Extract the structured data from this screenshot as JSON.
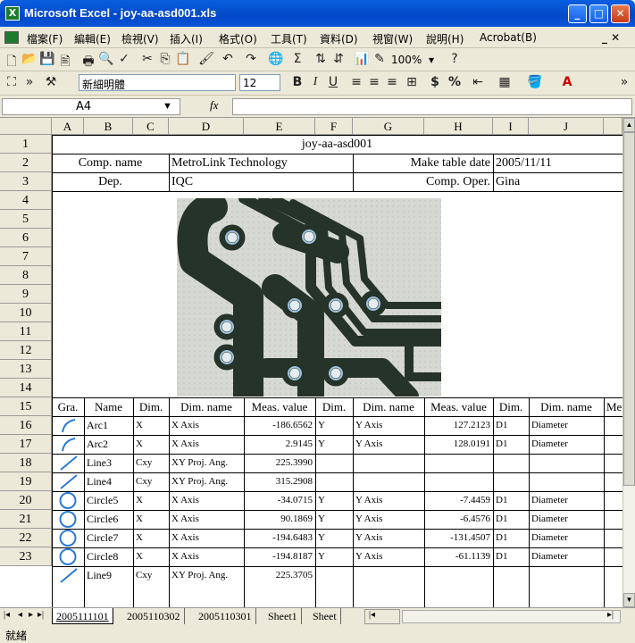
{
  "window": {
    "title": "Microsoft Excel - joy-aa-asd001.xls",
    "app_icon": "X"
  },
  "menu": [
    "檔案(F)",
    "編輯(E)",
    "檢視(V)",
    "插入(I)",
    "格式(O)",
    "工具(T)",
    "資料(D)",
    "視窗(W)",
    "說明(H)",
    "Acrobat(B)"
  ],
  "toolbar": {
    "zoom": "100%",
    "font": "新細明體",
    "font_size": "12",
    "bold": "B",
    "italic": "I",
    "underline": "U",
    "currency": "$",
    "percent": "%"
  },
  "formula_bar": {
    "name_box": "A4",
    "fx": "fx",
    "value": ""
  },
  "columns": [
    "A",
    "B",
    "C",
    "D",
    "E",
    "F",
    "G",
    "H",
    "I",
    "J"
  ],
  "rows": [
    "1",
    "2",
    "3",
    "4",
    "5",
    "6",
    "7",
    "8",
    "9",
    "10",
    "11",
    "12",
    "13",
    "14",
    "15",
    "16",
    "17",
    "18",
    "19",
    "20",
    "21",
    "22",
    "23"
  ],
  "sheet": {
    "title": "joy-aa-asd001",
    "comp_name_label": "Comp. name",
    "comp_name": "MetroLink Technology",
    "make_date_label": "Make table date",
    "make_date": "2005/11/11",
    "dep_label": "Dep.",
    "dep": "IQC",
    "oper_label": "Comp. Oper.",
    "oper": "Gina"
  },
  "headers": [
    "Gra.",
    "Name",
    "Dim.",
    "Dim. name",
    "Meas. value",
    "Dim.",
    "Dim. name",
    "Meas. value",
    "Dim.",
    "Dim. name",
    "Me"
  ],
  "data_rows": [
    {
      "gra": "arc",
      "name": "Arc1",
      "d1": "X",
      "n1": "X Axis",
      "v1": "-186.6562",
      "d2": "Y",
      "n2": "Y Axis",
      "v2": "127.2123",
      "d3": "D1",
      "n3": "Diameter"
    },
    {
      "gra": "arc",
      "name": "Arc2",
      "d1": "X",
      "n1": "X Axis",
      "v1": "2.9145",
      "d2": "Y",
      "n2": "Y Axis",
      "v2": "128.0191",
      "d3": "D1",
      "n3": "Diameter"
    },
    {
      "gra": "line",
      "name": "Line3",
      "d1": "Cxy",
      "n1": "XY Proj. Ang.",
      "v1": "225.3990",
      "d2": "",
      "n2": "",
      "v2": "",
      "d3": "",
      "n3": ""
    },
    {
      "gra": "line",
      "name": "Line4",
      "d1": "Cxy",
      "n1": "XY Proj. Ang.",
      "v1": "315.2908",
      "d2": "",
      "n2": "",
      "v2": "",
      "d3": "",
      "n3": ""
    },
    {
      "gra": "circle",
      "name": "Circle5",
      "d1": "X",
      "n1": "X Axis",
      "v1": "-34.0715",
      "d2": "Y",
      "n2": "Y Axis",
      "v2": "-7.4459",
      "d3": "D1",
      "n3": "Diameter"
    },
    {
      "gra": "circle",
      "name": "Circle6",
      "d1": "X",
      "n1": "X Axis",
      "v1": "90.1869",
      "d2": "Y",
      "n2": "Y Axis",
      "v2": "-6.4576",
      "d3": "D1",
      "n3": "Diameter"
    },
    {
      "gra": "circle",
      "name": "Circle7",
      "d1": "X",
      "n1": "X Axis",
      "v1": "-194.6483",
      "d2": "Y",
      "n2": "Y Axis",
      "v2": "-131.4507",
      "d3": "D1",
      "n3": "Diameter"
    },
    {
      "gra": "circle",
      "name": "Circle8",
      "d1": "X",
      "n1": "X Axis",
      "v1": "-194.8187",
      "d2": "Y",
      "n2": "Y Axis",
      "v2": "-61.1139",
      "d3": "D1",
      "n3": "Diameter"
    },
    {
      "gra": "line",
      "name": "Line9",
      "d1": "Cxy",
      "n1": "XY Proj. Ang.",
      "v1": "225.3705",
      "d2": "",
      "n2": "",
      "v2": "",
      "d3": "",
      "n3": ""
    }
  ],
  "sheet_tabs": [
    "2005111101",
    "2005110302",
    "2005110301",
    "Sheet1",
    "Sheet"
  ],
  "status": "就緒",
  "colors": {
    "title_bar": "#0348c8",
    "chrome": "#ece9d8",
    "graphic_stroke": "#2a7ad6",
    "board": "#2b3a30",
    "copper": "#d8dcd6"
  }
}
